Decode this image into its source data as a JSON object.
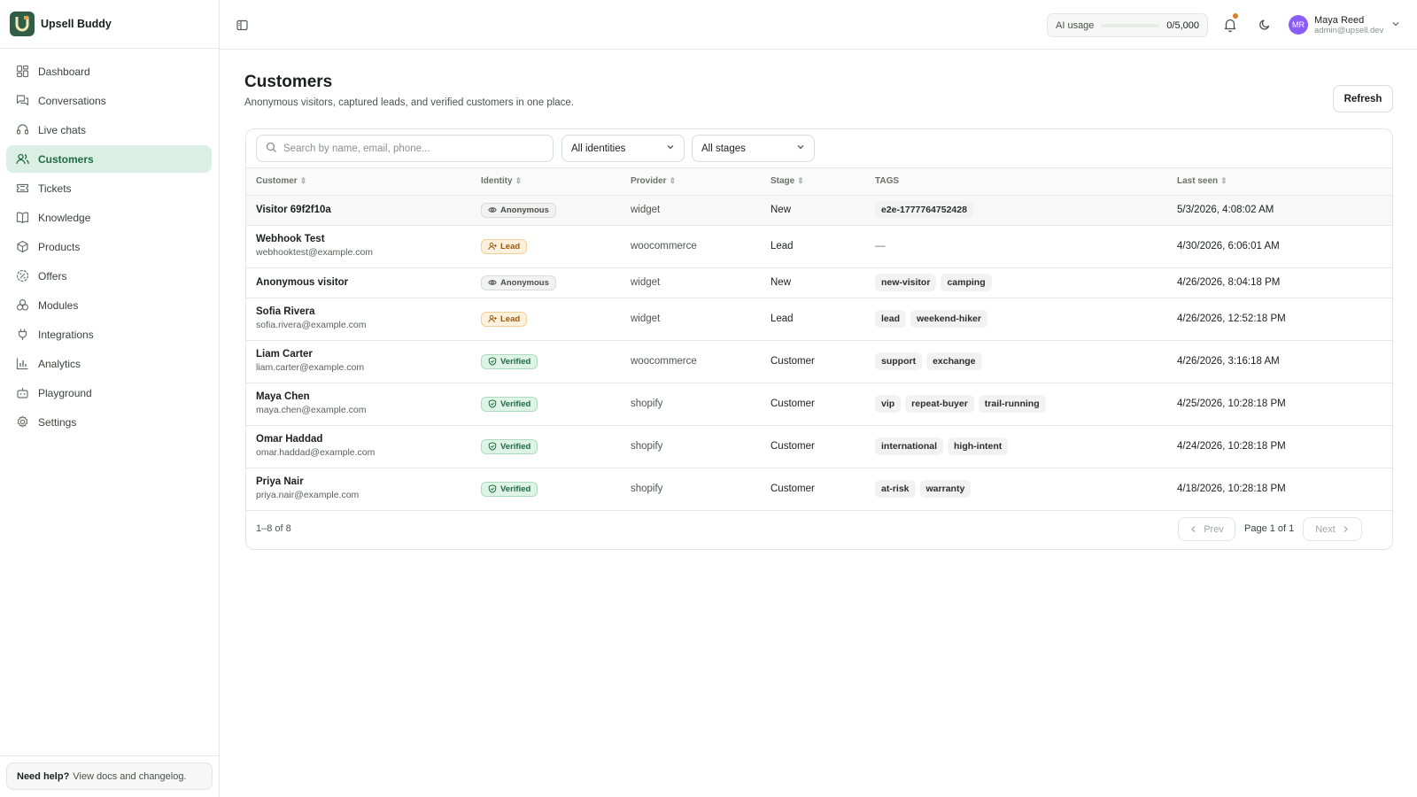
{
  "app": {
    "name": "Upsell Buddy"
  },
  "sidebar": {
    "items": [
      {
        "label": "Dashboard",
        "icon": "dashboard-icon"
      },
      {
        "label": "Conversations",
        "icon": "chat-icon"
      },
      {
        "label": "Live chats",
        "icon": "headset-icon"
      },
      {
        "label": "Customers",
        "icon": "users-icon",
        "active": true
      },
      {
        "label": "Tickets",
        "icon": "ticket-icon"
      },
      {
        "label": "Knowledge",
        "icon": "book-icon"
      },
      {
        "label": "Products",
        "icon": "box-icon"
      },
      {
        "label": "Offers",
        "icon": "percent-icon"
      },
      {
        "label": "Modules",
        "icon": "modules-icon"
      },
      {
        "label": "Integrations",
        "icon": "plug-icon"
      },
      {
        "label": "Analytics",
        "icon": "chart-icon"
      },
      {
        "label": "Playground",
        "icon": "bot-icon"
      },
      {
        "label": "Settings",
        "icon": "gear-icon"
      }
    ],
    "help": {
      "bold": "Need help?",
      "text": "View docs and changelog."
    }
  },
  "topbar": {
    "ai_usage": {
      "label": "AI usage",
      "value": "0/5,000",
      "fraction": 0
    },
    "notifications_unread": true,
    "user": {
      "initials": "MR",
      "name": "Maya Reed",
      "email": "admin@upsell.dev"
    }
  },
  "page": {
    "title": "Customers",
    "subtitle": "Anonymous visitors, captured leads, and verified customers in one place.",
    "refresh_label": "Refresh"
  },
  "filters": {
    "search_placeholder": "Search by name, email, phone...",
    "identity": "All identities",
    "stage": "All stages"
  },
  "table": {
    "headers": {
      "customer": "Customer",
      "identity": "Identity",
      "provider": "Provider",
      "stage": "Stage",
      "tags": "TAGS",
      "last_seen": "Last seen"
    },
    "rows": [
      {
        "name": "Visitor 69f2f10a",
        "email": "",
        "identity": "Anonymous",
        "provider": "widget",
        "stage": "New",
        "tags": [
          "e2e-1777764752428"
        ],
        "last_seen": "5/3/2026, 4:08:02 AM"
      },
      {
        "name": "Webhook Test",
        "email": "webhooktest@example.com",
        "identity": "Lead",
        "provider": "woocommerce",
        "stage": "Lead",
        "tags": [],
        "last_seen": "4/30/2026, 6:06:01 AM"
      },
      {
        "name": "Anonymous visitor",
        "email": "",
        "identity": "Anonymous",
        "provider": "widget",
        "stage": "New",
        "tags": [
          "new-visitor",
          "camping"
        ],
        "last_seen": "4/26/2026, 8:04:18 PM"
      },
      {
        "name": "Sofia Rivera",
        "email": "sofia.rivera@example.com",
        "identity": "Lead",
        "provider": "widget",
        "stage": "Lead",
        "tags": [
          "lead",
          "weekend-hiker"
        ],
        "last_seen": "4/26/2026, 12:52:18 PM"
      },
      {
        "name": "Liam Carter",
        "email": "liam.carter@example.com",
        "identity": "Verified",
        "provider": "woocommerce",
        "stage": "Customer",
        "tags": [
          "support",
          "exchange"
        ],
        "last_seen": "4/26/2026, 3:16:18 AM"
      },
      {
        "name": "Maya Chen",
        "email": "maya.chen@example.com",
        "identity": "Verified",
        "provider": "shopify",
        "stage": "Customer",
        "tags": [
          "vip",
          "repeat-buyer",
          "trail-running"
        ],
        "last_seen": "4/25/2026, 10:28:18 PM"
      },
      {
        "name": "Omar Haddad",
        "email": "omar.haddad@example.com",
        "identity": "Verified",
        "provider": "shopify",
        "stage": "Customer",
        "tags": [
          "international",
          "high-intent"
        ],
        "last_seen": "4/24/2026, 10:28:18 PM"
      },
      {
        "name": "Priya Nair",
        "email": "priya.nair@example.com",
        "identity": "Verified",
        "provider": "shopify",
        "stage": "Customer",
        "tags": [
          "at-risk",
          "warranty"
        ],
        "last_seen": "4/18/2026, 10:28:18 PM"
      }
    ],
    "empty_tags": "—"
  },
  "pagination": {
    "count": "1–8 of 8",
    "prev": "Prev",
    "next": "Next",
    "page": "Page 1 of 1"
  }
}
